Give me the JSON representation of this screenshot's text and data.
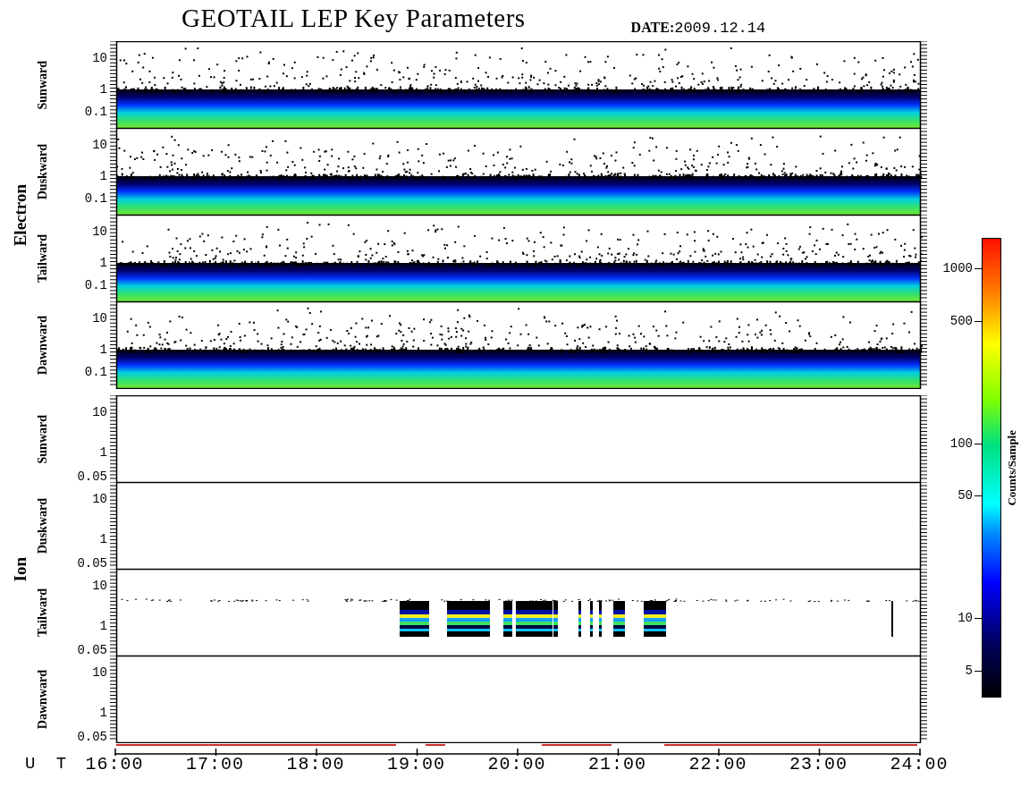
{
  "title": "GEOTAIL LEP Key Parameters",
  "date": {
    "label": "DATE:",
    "value": "2009.12.14"
  },
  "groups": [
    {
      "name": "Electron",
      "panels": [
        {
          "direction": "Sunward",
          "kind": "band",
          "yticks": [
            "10",
            "1",
            "0.1"
          ]
        },
        {
          "direction": "Duskward",
          "kind": "band",
          "yticks": [
            "10",
            "1",
            "0.1"
          ]
        },
        {
          "direction": "Tailward",
          "kind": "band",
          "yticks": [
            "10",
            "1",
            "0.1"
          ]
        },
        {
          "direction": "Dawnward",
          "kind": "band",
          "yticks": [
            "10",
            "1",
            "0.1"
          ]
        }
      ]
    },
    {
      "name": "Ion",
      "panels": [
        {
          "direction": "Sunward",
          "kind": "empty",
          "yticks": [
            "10",
            "1",
            "0.05"
          ]
        },
        {
          "direction": "Duskward",
          "kind": "empty",
          "yticks": [
            "10",
            "1",
            "0.05"
          ]
        },
        {
          "direction": "Tailward",
          "kind": "burst",
          "yticks": [
            "10",
            "1",
            "0.05"
          ]
        },
        {
          "direction": "Dawnward",
          "kind": "empty",
          "yticks": [
            "10",
            "1",
            "0.05"
          ]
        }
      ]
    }
  ],
  "colorbar": {
    "label": "Counts/Sample",
    "ticks": [
      "1000",
      "500",
      "100",
      "50",
      "10",
      "5"
    ]
  },
  "time_axis": {
    "label": "U T",
    "ticks": [
      "16:00",
      "17:00",
      "18:00",
      "19:00",
      "20:00",
      "21:00",
      "22:00",
      "23:00",
      "24:00"
    ]
  }
}
